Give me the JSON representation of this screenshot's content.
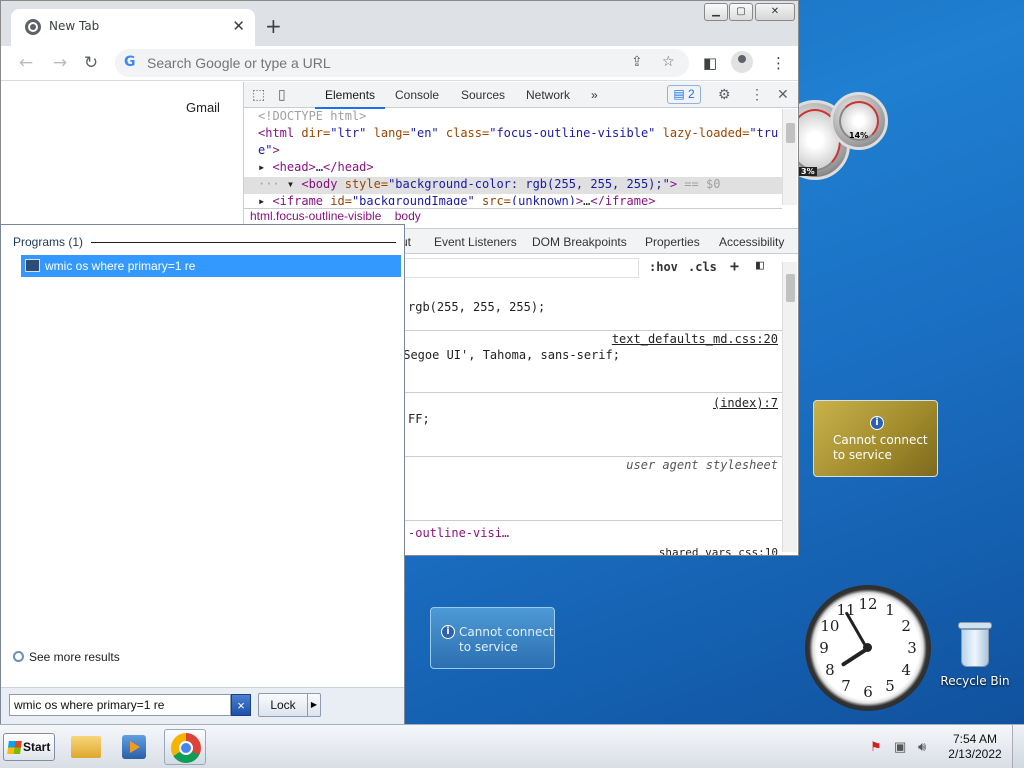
{
  "desktop": {
    "gauge_small_label": "14%",
    "gauge_big_label": "3%",
    "weather_text": [
      "Cannot connect",
      "to service"
    ],
    "slideshow_text": [
      "Cannot connect",
      "to service"
    ],
    "clock_numbers": [
      "12",
      "1",
      "2",
      "3",
      "4",
      "5",
      "6",
      "7",
      "8",
      "9",
      "10",
      "11"
    ],
    "recycle_bin_label": "Recycle Bin"
  },
  "chrome": {
    "tab_title": "New Tab",
    "omnibox_placeholder": "Search Google or type a URL",
    "gmail_link": "Gmail",
    "devtools": {
      "tabs": [
        "Elements",
        "Console",
        "Sources",
        "Network"
      ],
      "more_tabs": "»",
      "issues_count": "2",
      "code_lines": [
        {
          "parts": [
            [
              "gray",
              "<!DOCTYPE html>"
            ]
          ]
        },
        {
          "parts": [
            [
              "tag",
              "<html "
            ],
            [
              "attr",
              "dir="
            ],
            [
              "val",
              "\"ltr\""
            ],
            [
              "attr",
              " lang="
            ],
            [
              "val",
              "\"en\""
            ],
            [
              "attr",
              " class="
            ],
            [
              "val",
              "\"focus-outline-visible\""
            ],
            [
              "attr",
              " lazy-loaded="
            ],
            [
              "val",
              "\"tru"
            ]
          ]
        },
        {
          "parts": [
            [
              "val",
              "e\""
            ],
            [
              "tag",
              ">"
            ]
          ]
        },
        {
          "parts": [
            [
              "txt",
              "▸ "
            ],
            [
              "tag",
              "<head>"
            ],
            [
              "txt",
              "…"
            ],
            [
              "tag",
              "</head>"
            ]
          ]
        },
        {
          "parts": [
            [
              "gray",
              "··· "
            ],
            [
              "txt",
              "▾ "
            ],
            [
              "tag",
              "<body "
            ],
            [
              "attr",
              "style="
            ],
            [
              "val",
              "\"background-color: rgb(255, 255, 255);\""
            ],
            [
              "tag",
              ">"
            ],
            [
              "gray",
              " == $0"
            ]
          ]
        },
        {
          "parts": [
            [
              "txt",
              "  ▸ "
            ],
            [
              "tag",
              "<iframe "
            ],
            [
              "attr",
              "id="
            ],
            [
              "val",
              "\"backgroundImage\""
            ],
            [
              "attr",
              " src="
            ],
            [
              "val",
              "(unknown)"
            ],
            [
              "tag",
              ">"
            ],
            [
              "txt",
              "…"
            ],
            [
              "tag",
              "</iframe>"
            ]
          ]
        }
      ],
      "breadcrumbs": [
        "html.focus-outline-visible",
        "body"
      ],
      "sub_tabs": [
        "ut",
        "Event Listeners",
        "DOM Breakpoints",
        "Properties",
        "Accessibility"
      ],
      "styles_tools": [
        ":hov",
        ".cls",
        "+"
      ],
      "style_lines": [
        "rgb(255, 255, 255);",
        "'Segoe UI', Tahoma, sans-serif;",
        "FF;",
        "-outline-visi…"
      ],
      "style_sources": [
        "text_defaults_md.css:20",
        "(index):7",
        "shared_vars_css:10"
      ],
      "ua_source": "user agent stylesheet"
    }
  },
  "startmenu": {
    "programs_header": "Programs (1)",
    "result": "wmic os where primary=1 re",
    "see_more": "See more results",
    "search_value": "wmic os where primary=1 re",
    "clear_glyph": "×",
    "lock_label": "Lock",
    "lock_arrow": "▶"
  },
  "taskbar": {
    "start_label": "Start",
    "time": "7:54 AM",
    "date": "2/13/2022"
  }
}
